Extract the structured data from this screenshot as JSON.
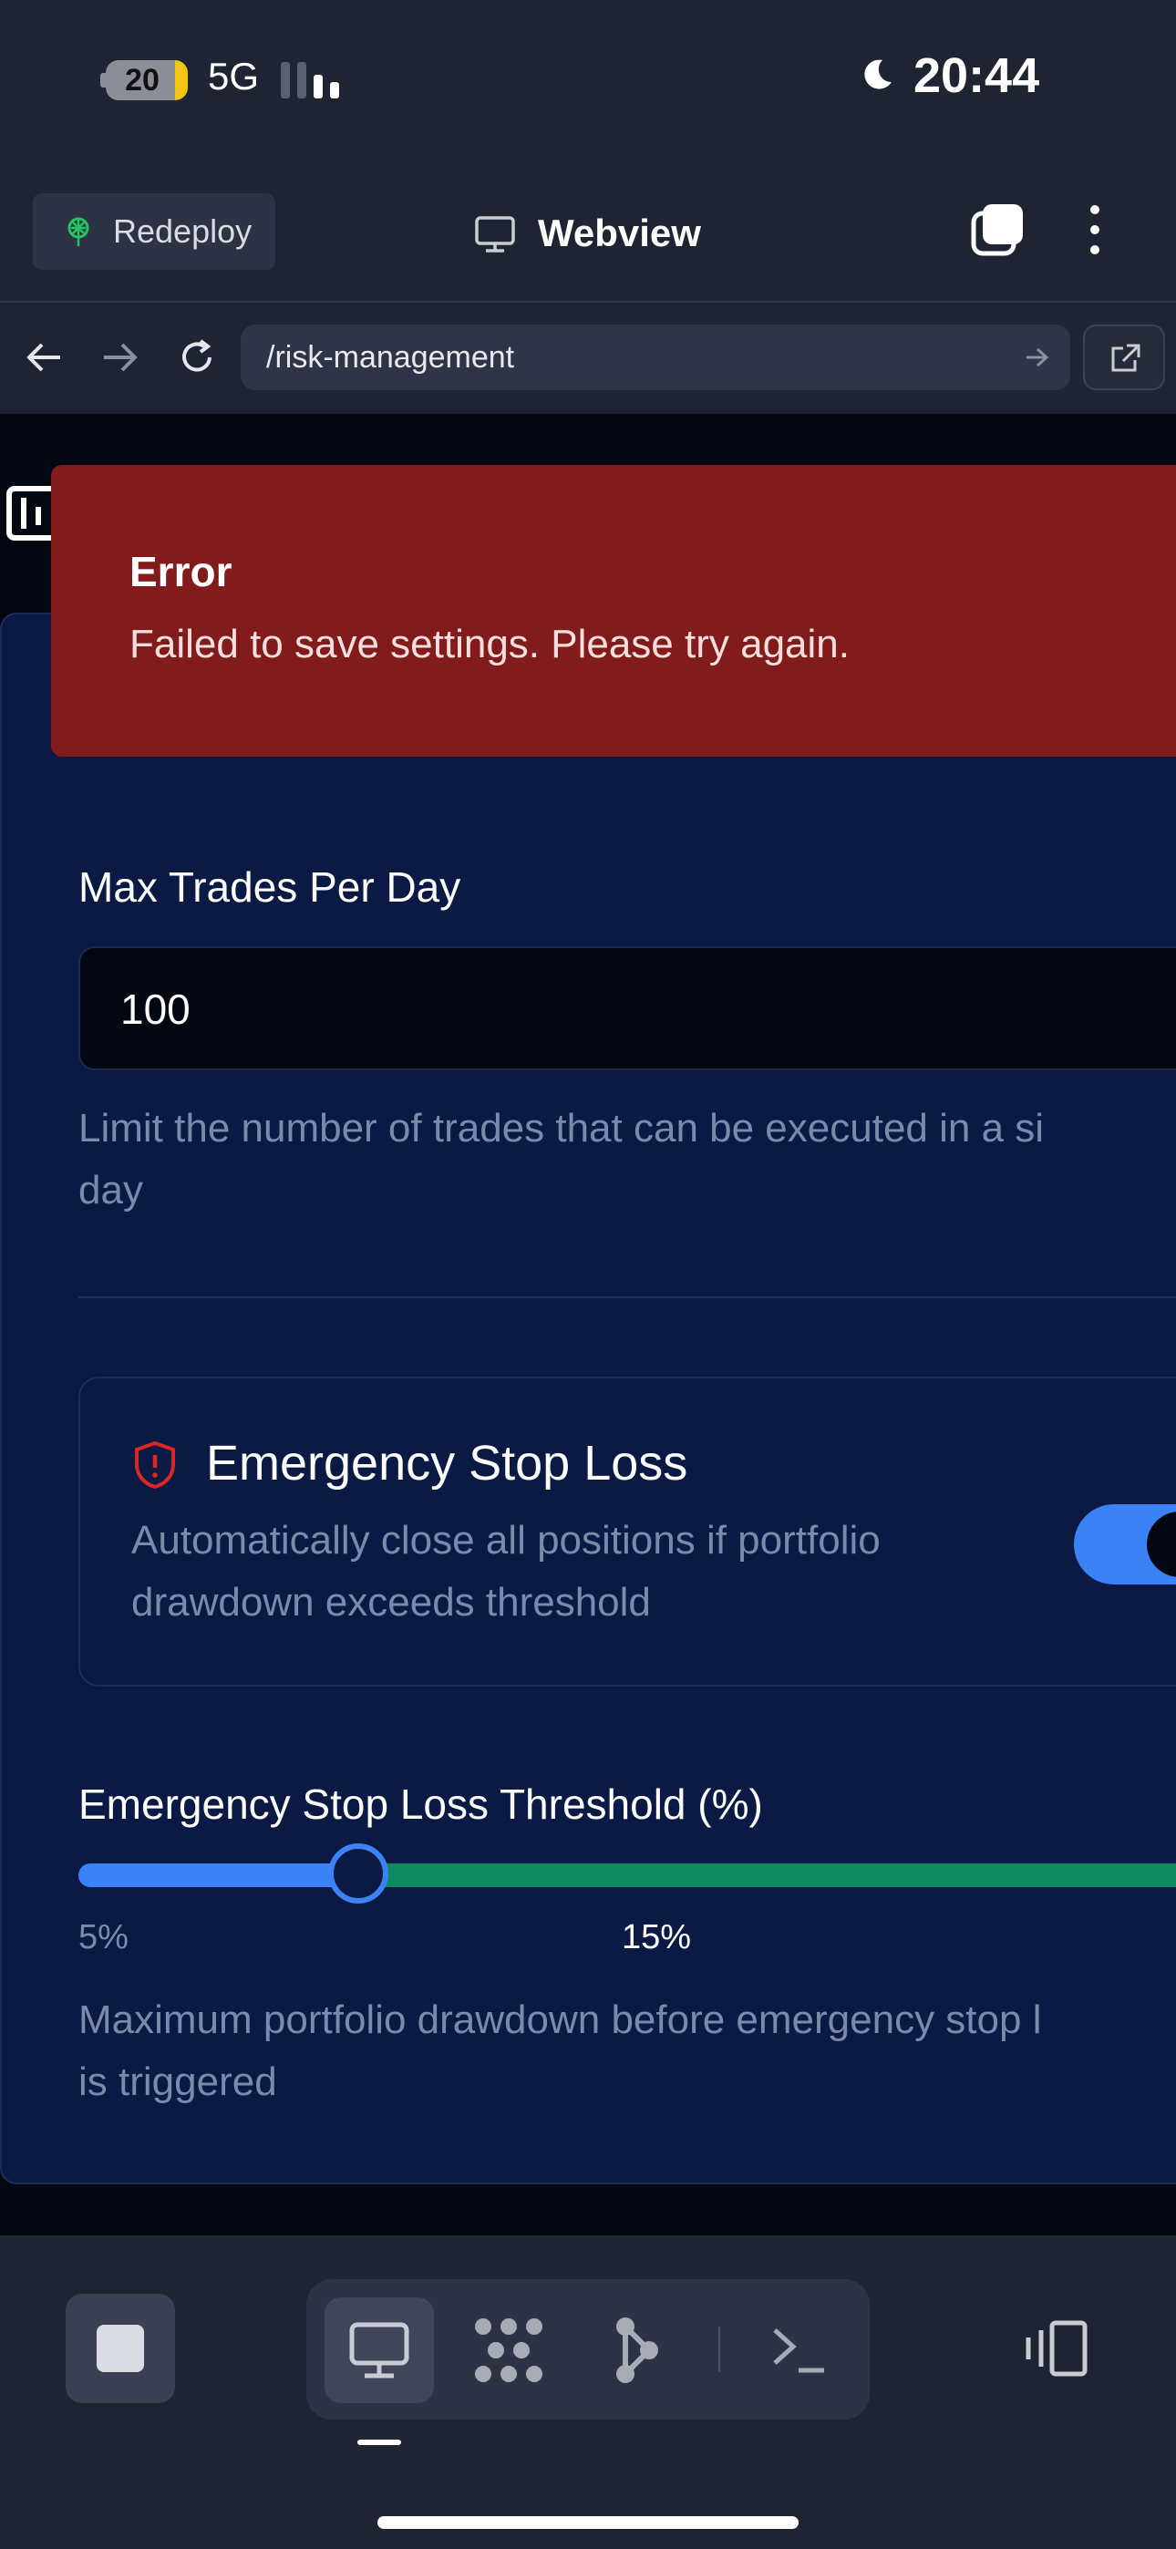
{
  "status_bar": {
    "battery": "20",
    "network": "5G",
    "time": "20:44",
    "icons": [
      "battery-icon",
      "signal-bars-icon",
      "moon-icon"
    ]
  },
  "toolbar": {
    "redeploy_label": "Redeploy",
    "title": "Webview",
    "icons": [
      "redeploy-icon",
      "monitor-icon",
      "tabs-icon",
      "more-vertical-icon"
    ]
  },
  "navbar": {
    "url": "/risk-management",
    "icons": [
      "back-arrow-icon",
      "forward-arrow-icon",
      "reload-icon",
      "go-arrow-icon",
      "external-link-icon"
    ]
  },
  "toast": {
    "title": "Error",
    "message": "Failed to save settings. Please try again."
  },
  "settings": {
    "max_trades": {
      "label": "Max Trades Per Day",
      "value": "100",
      "help_line1": "Limit the number of trades that can be executed in a si",
      "help_line2": "day"
    },
    "emergency_stop": {
      "title": "Emergency Stop Loss",
      "desc_line1": "Automatically close all positions if portfolio",
      "desc_line2": "drawdown exceeds threshold",
      "enabled": true
    },
    "threshold": {
      "label": "Emergency Stop Loss Threshold (%)",
      "min_label": "5%",
      "value_label": "15%",
      "value_percent": 15,
      "help_line1": "Maximum portfolio drawdown before emergency stop l",
      "help_line2": "is triggered"
    }
  },
  "bottom_bar": {
    "icons": [
      "stop-icon",
      "desktop-icon",
      "grid-dots-icon",
      "graph-icon",
      "terminal-icon",
      "devices-icon"
    ]
  },
  "colors": {
    "accent": "#3b82f6",
    "error": "#821c1c",
    "success": "#0e8a63",
    "card": "#0b1a45"
  }
}
